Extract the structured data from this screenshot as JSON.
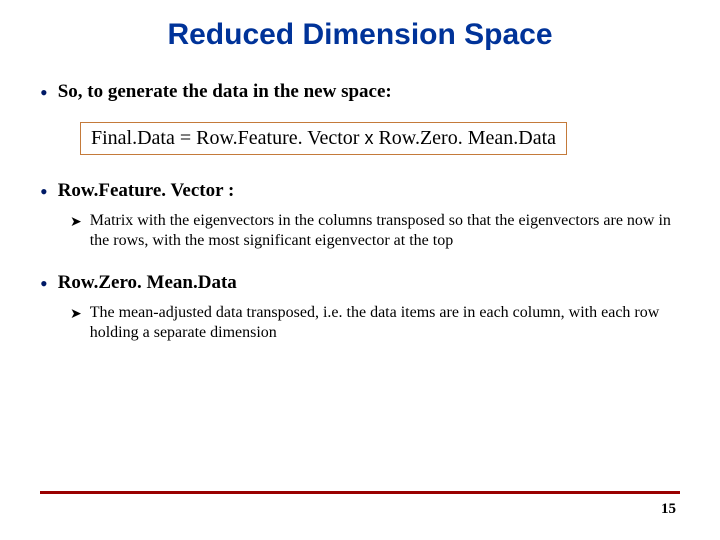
{
  "title": "Reduced Dimension Space",
  "bullets": {
    "b1": {
      "text": "So, to generate the data in the new space:"
    },
    "equation": {
      "lhs": "Final.Data",
      "eq": " = ",
      "rhs1": "Row.Feature. Vector",
      "x": " x ",
      "rhs2": "Row.Zero. Mean.Data"
    },
    "b2": {
      "heading": "Row.Feature. Vector :"
    },
    "b2sub": "Matrix with the eigenvectors in the columns transposed so that the eigenvectors are now in the rows, with the most significant eigenvector at the top",
    "b3": {
      "heading": "Row.Zero. Mean.Data"
    },
    "b3sub": "The mean-adjusted data transposed, i.e. the data items are in each column, with each row holding a separate dimension"
  },
  "markers": {
    "dot": "•",
    "sub": "➤"
  },
  "page_number": "15"
}
